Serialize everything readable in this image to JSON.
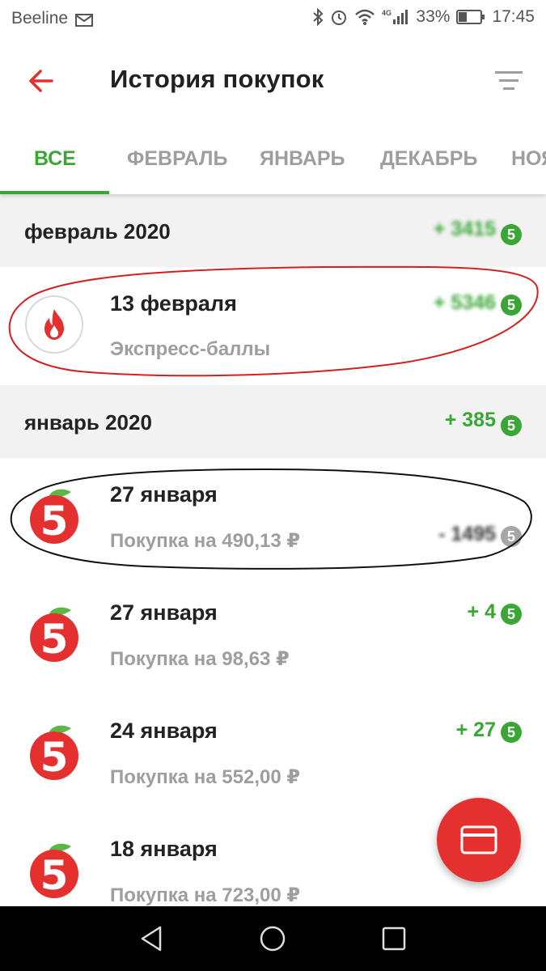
{
  "status_bar": {
    "carrier": "Beeline",
    "battery": "33%",
    "time": "17:45",
    "icons": [
      "envelope-icon",
      "bluetooth-icon",
      "alarm-icon",
      "wifi-icon",
      "4g-signal-icon",
      "battery-icon"
    ]
  },
  "app_bar": {
    "title": "История покупок",
    "back_icon": "arrow-left-icon",
    "filter_icon": "filter-icon"
  },
  "tabs": {
    "items": [
      "ВСЕ",
      "ФЕВРАЛЬ",
      "ЯНВАРЬ",
      "ДЕКАБРЬ",
      "НОЯ"
    ],
    "active": "ВСЕ"
  },
  "groups": [
    {
      "month": "февраль 2020",
      "total": "+ 3415",
      "total_obscured": true,
      "rows": [
        {
          "date": "13 февраля",
          "desc": "Экспресс-баллы",
          "amount": "+ 5346",
          "amount_obscured": true,
          "icon": "flame-icon"
        }
      ]
    },
    {
      "month": "январь 2020",
      "total": "+ 385",
      "rows": [
        {
          "date": "27 января",
          "desc": "Покупка на 490,13 ₽",
          "amount": "- 1495",
          "amount_obscured": true,
          "negative": true,
          "icon": "pyaterochka-logo-icon"
        },
        {
          "date": "27 января",
          "desc": "Покупка на 98,63 ₽",
          "amount": "+ 4",
          "icon": "pyaterochka-logo-icon"
        },
        {
          "date": "24 января",
          "desc": "Покупка на 552,00 ₽",
          "amount": "+ 27",
          "icon": "pyaterochka-logo-icon"
        },
        {
          "date": "18 января",
          "desc": "Покупка на 723,00 ₽",
          "amount": "",
          "icon": "pyaterochka-logo-icon"
        }
      ]
    }
  ],
  "coin_glyph": "5",
  "fab": {
    "icon": "card-icon"
  },
  "nav": {
    "icons": [
      "back-triangle-icon",
      "home-circle-icon",
      "recents-square-icon"
    ]
  },
  "colors": {
    "accent_green": "#3aa635",
    "brand_red": "#e53030",
    "muted_text": "#9e9e9e",
    "section_bg": "#f2f2f2"
  }
}
